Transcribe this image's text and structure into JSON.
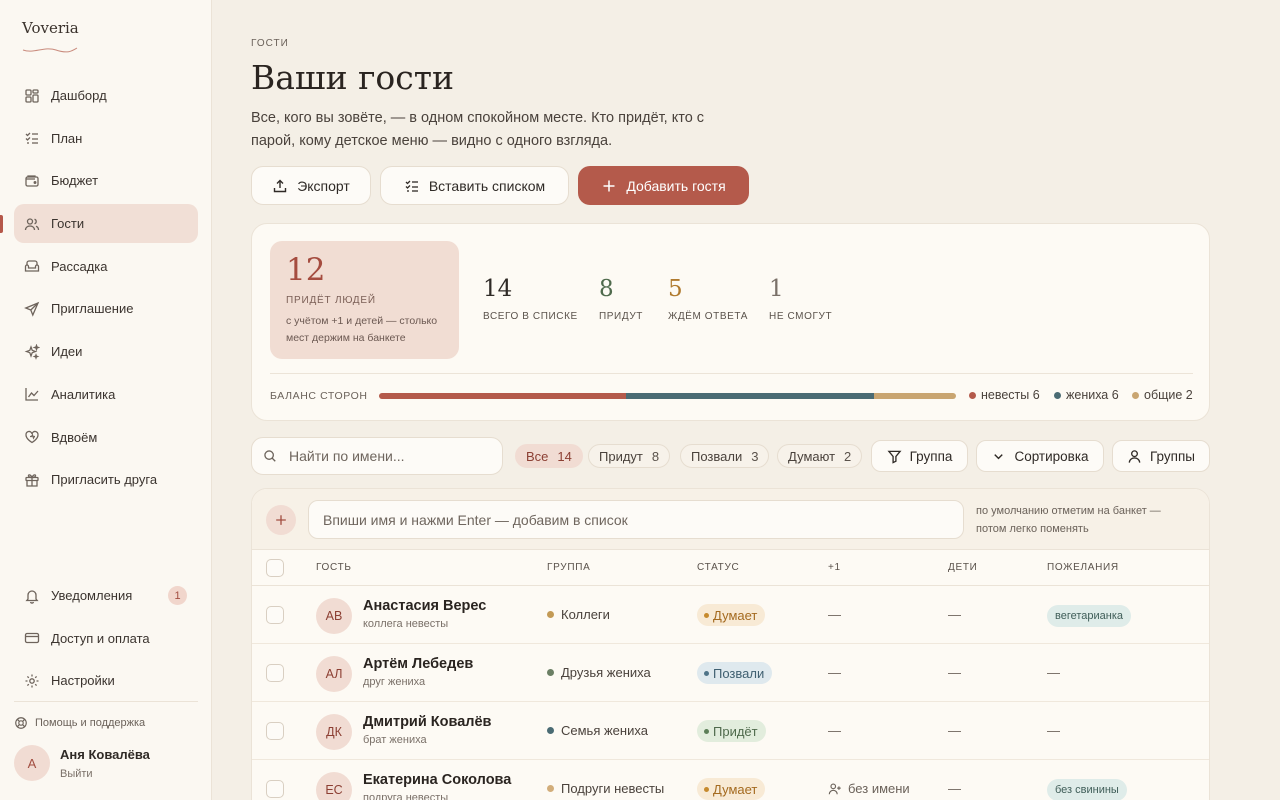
{
  "app": {
    "logo": "Voveria"
  },
  "sidebar": {
    "items": [
      {
        "label": "Дашборд",
        "icon": "dashboard-icon"
      },
      {
        "label": "План",
        "icon": "checklist-icon"
      },
      {
        "label": "Бюджет",
        "icon": "wallet-icon"
      },
      {
        "label": "Гости",
        "icon": "users-icon",
        "active": true
      },
      {
        "label": "Рассадка",
        "icon": "sofa-icon"
      },
      {
        "label": "Приглашение",
        "icon": "send-icon"
      },
      {
        "label": "Идеи",
        "icon": "sparkles-icon"
      },
      {
        "label": "Аналитика",
        "icon": "chart-icon"
      },
      {
        "label": "Вдвоём",
        "icon": "hearts-icon"
      },
      {
        "label": "Пригласить друга",
        "icon": "gift-icon"
      }
    ],
    "bottom": [
      {
        "label": "Уведомления",
        "icon": "bell-icon",
        "badge": "1"
      },
      {
        "label": "Доступ и оплата",
        "icon": "card-icon"
      },
      {
        "label": "Настройки",
        "icon": "gear-icon"
      }
    ],
    "help": "Помощь и поддержка",
    "user": {
      "initial": "А",
      "name": "Аня Ковалёва",
      "logout": "Выйти"
    }
  },
  "header": {
    "eyebrow": "ГОСТИ",
    "title": "Ваши гости",
    "description": "Все, кого вы зовёте, — в одном спокойном месте. Кто придёт, кто с парой, кому детское меню — видно с одного взгляда."
  },
  "actions": {
    "export": "Экспорт",
    "paste": "Вставить списком",
    "add": "Добавить гостя"
  },
  "stats": {
    "hero": {
      "value": "12",
      "label": "ПРИДЁТ ЛЮДЕЙ",
      "note": "с учётом +1 и детей — столько мест держим на банкете"
    },
    "items": [
      {
        "value": "14",
        "label": "ВСЕГО В СПИСКЕ",
        "color": "#2f2a26"
      },
      {
        "value": "8",
        "label": "ПРИДУТ",
        "color": "#4f6a4c"
      },
      {
        "value": "5",
        "label": "ЖДЁМ ОТВЕТА",
        "color": "#b07a2e"
      },
      {
        "value": "1",
        "label": "НЕ СМОГУТ",
        "color": "#7a7068"
      }
    ],
    "balance": {
      "label": "БАЛАНС СТОРОН",
      "sides": [
        {
          "label": "невесты 6",
          "value": 6,
          "color": "#b45a4b"
        },
        {
          "label": "жениха 6",
          "value": 6,
          "color": "#4a6b73"
        },
        {
          "label": "общие 2",
          "value": 2,
          "color": "#c9a571"
        }
      ]
    }
  },
  "toolbar": {
    "search_placeholder": "Найти по имени...",
    "filters": [
      {
        "label": "Все",
        "count": "14",
        "active": true
      },
      {
        "label": "Придут",
        "count": "8"
      },
      {
        "label": "Позвали",
        "count": "3"
      },
      {
        "label": "Думают",
        "count": "2"
      }
    ],
    "group_filter": "Группа",
    "sort": "Сортировка",
    "groups": "Группы"
  },
  "quick_add": {
    "placeholder": "Впиши имя и нажми Enter — добавим в список",
    "hint": "по умолчанию отметим на банкет — потом легко поменять"
  },
  "table": {
    "columns": {
      "guest": "ГОСТЬ",
      "group": "ГРУППА",
      "status": "СТАТУС",
      "plus": "+1",
      "kids": "ДЕТИ",
      "wishes": "ПОЖЕЛАНИЯ"
    },
    "rows": [
      {
        "initials": "АВ",
        "name": "Анастасия Верес",
        "role": "коллега невесты",
        "group": "Коллеги",
        "group_color": "#c39a55",
        "status": "Думает",
        "status_kind": "thinking",
        "plus": "—",
        "kids": "—",
        "wish": "вегетарианка"
      },
      {
        "initials": "АЛ",
        "name": "Артём Лебедев",
        "role": "друг жениха",
        "group": "Друзья жениха",
        "group_color": "#6b7f64",
        "status": "Позвали",
        "status_kind": "invited",
        "plus": "—",
        "kids": "—",
        "wish": "—"
      },
      {
        "initials": "ДК",
        "name": "Дмитрий Ковалёв",
        "role": "брат жениха",
        "group": "Семья жениха",
        "group_color": "#4a6b73",
        "status": "Придёт",
        "status_kind": "coming",
        "plus": "—",
        "kids": "—",
        "wish": "—"
      },
      {
        "initials": "ЕС",
        "name": "Екатерина Соколова",
        "role": "подруга невесты",
        "group": "Подруги невесты",
        "group_color": "#d2ad7a",
        "status": "Думает",
        "status_kind": "thinking",
        "plus": "без имени",
        "plus_icon": true,
        "kids": "—",
        "wish": "без свинины"
      }
    ]
  }
}
